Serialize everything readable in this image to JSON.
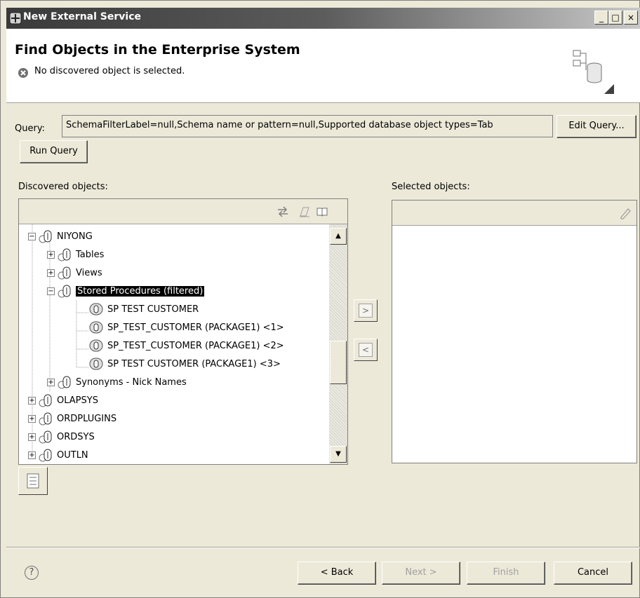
{
  "window": {
    "title": "New External Service",
    "controls": [
      "_",
      "□",
      "×"
    ]
  },
  "header": {
    "heading": "Find Objects in the Enterprise System",
    "message": "No discovered object is selected."
  },
  "query": {
    "label": "Query:",
    "value": "SchemaFilterLabel=null,Schema name or pattern=null,Supported database object types=Tab",
    "edit_button": "Edit Query...",
    "run_button": "Run Query"
  },
  "discovered": {
    "label": "Discovered objects:",
    "tree": [
      {
        "label": "NIYONG",
        "expander": "−",
        "kind": "schema"
      },
      {
        "label": "Tables",
        "expander": "+",
        "kind": "schema"
      },
      {
        "label": "Views",
        "expander": "+",
        "kind": "schema"
      },
      {
        "label": "Stored Procedures (filtered)",
        "expander": "−",
        "kind": "schema",
        "selected": true
      },
      {
        "label": "SP  TEST  CUSTOMER",
        "kind": "proc"
      },
      {
        "label": "SP_TEST_CUSTOMER (PACKAGE1) <1>",
        "kind": "proc"
      },
      {
        "label": "SP_TEST_CUSTOMER (PACKAGE1) <2>",
        "kind": "proc"
      },
      {
        "label": "SP  TEST  CUSTOMER (PACKAGE1) <3>",
        "kind": "proc"
      },
      {
        "label": "Synonyms - Nick Names",
        "expander": "+",
        "kind": "schema"
      },
      {
        "label": "OLAPSYS",
        "expander": "+",
        "kind": "schema"
      },
      {
        "label": "ORDPLUGINS",
        "expander": "+",
        "kind": "schema"
      },
      {
        "label": "ORDSYS",
        "expander": "+",
        "kind": "schema"
      },
      {
        "label": "OUTLN",
        "expander": "+",
        "kind": "schema"
      }
    ]
  },
  "move": {
    "add": ">",
    "remove": "<"
  },
  "selected": {
    "label": "Selected objects:"
  },
  "footer": {
    "help": "?",
    "back": "< Back",
    "next": "Next >",
    "finish": "Finish",
    "cancel": "Cancel"
  }
}
